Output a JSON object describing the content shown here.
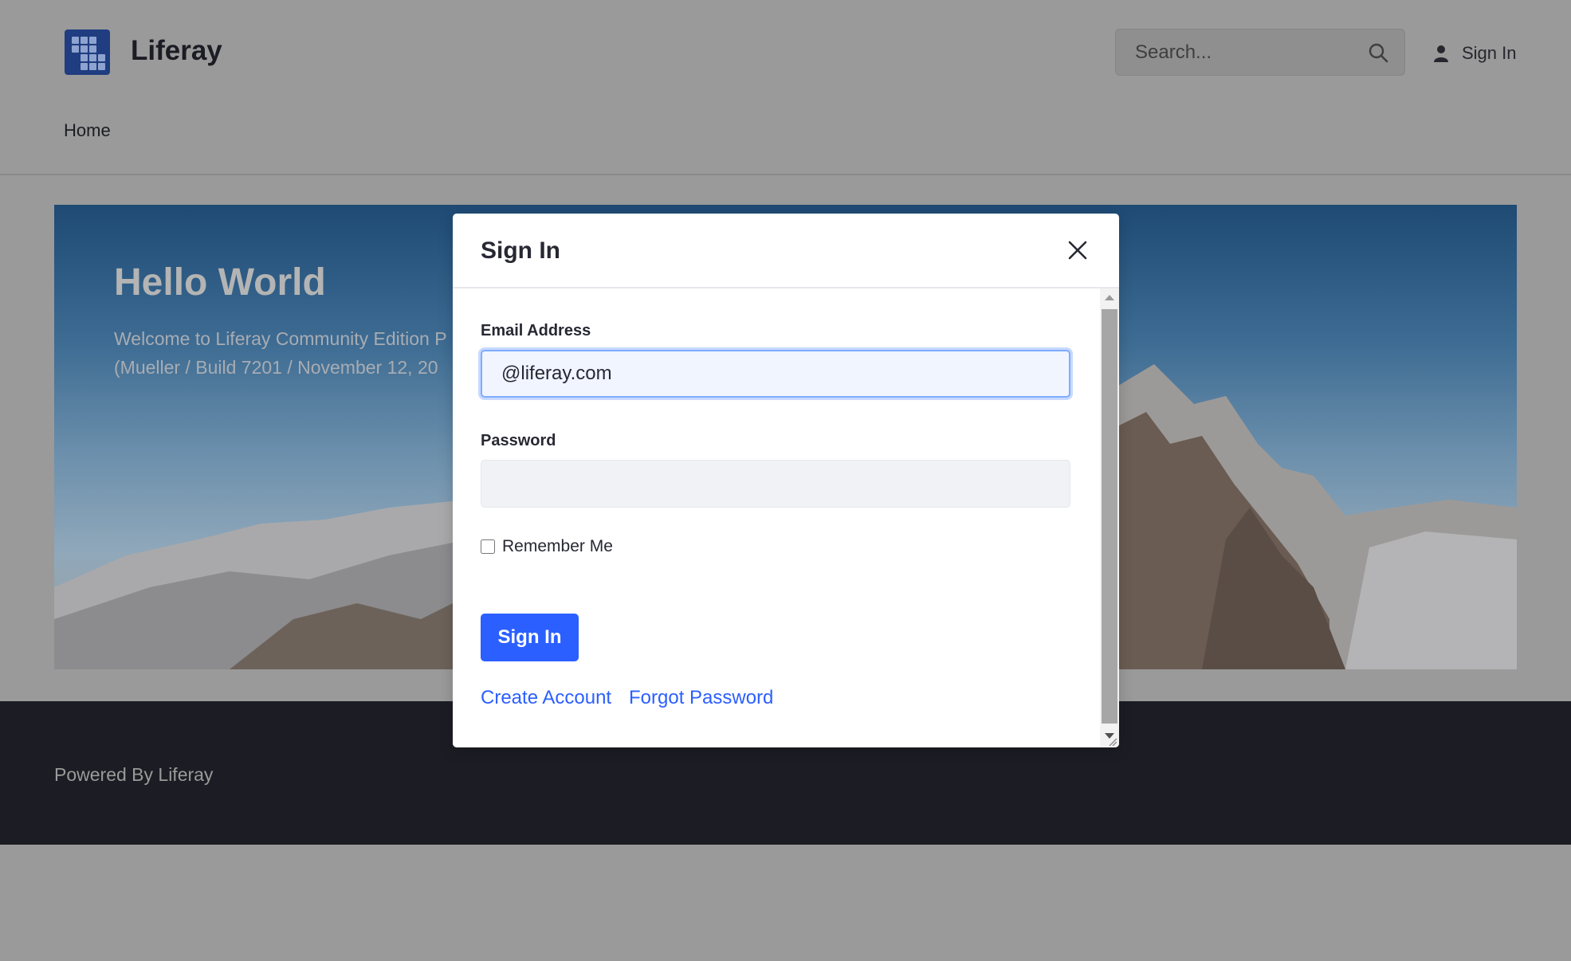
{
  "header": {
    "site_name": "Liferay",
    "search_placeholder": "Search...",
    "sign_in_label": "Sign In",
    "nav_home": "Home"
  },
  "hero": {
    "title": "Hello World",
    "text_line1": "Welcome to Liferay Community Edition P",
    "text_line2": "(Mueller / Build 7201 / November 12, 20"
  },
  "footer": {
    "text": "Powered By Liferay"
  },
  "modal": {
    "title": "Sign In",
    "email_label": "Email Address",
    "email_value": "@liferay.com",
    "password_label": "Password",
    "password_value": "",
    "remember_label": "Remember Me",
    "remember_checked": false,
    "submit_label": "Sign In",
    "create_account_label": "Create Account",
    "forgot_password_label": "Forgot Password"
  },
  "colors": {
    "primary": "#2b5fff",
    "footer_bg": "#1c1c24",
    "logo_bg": "#1f3d80"
  },
  "icons": {
    "search": "search-icon",
    "user": "user-icon",
    "close": "close-icon"
  }
}
